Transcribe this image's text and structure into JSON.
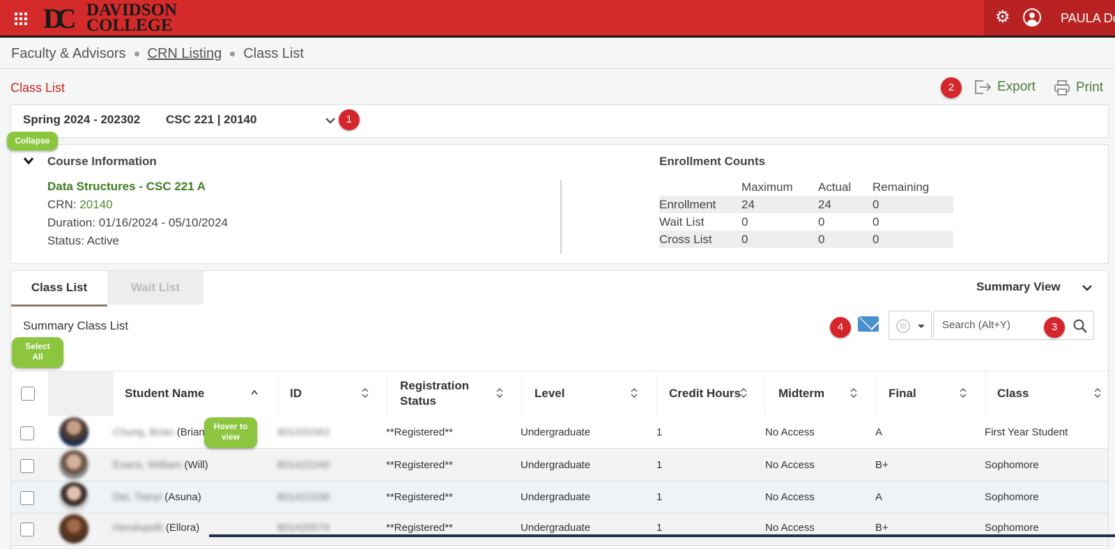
{
  "header": {
    "college_line1": "DAVIDSON",
    "college_line2": "COLLEGE",
    "logo_mark": "DC",
    "username": "PAULA Do",
    "brand_color": "#d42a2a"
  },
  "breadcrumb": {
    "items": [
      "Faculty & Advisors",
      "CRN Listing",
      "Class List"
    ]
  },
  "page_title": "Class List",
  "toolbar": {
    "export_label": "Export",
    "print_label": "Print"
  },
  "badges": [
    "1",
    "2",
    "3",
    "4"
  ],
  "course_selector": {
    "term": "Spring 2024 - 202302",
    "course": "CSC 221 | 20140"
  },
  "callouts": {
    "collapse": "Collapse",
    "select_all_1": "Select",
    "select_all_2": "All",
    "hover_1": "Hover to",
    "hover_2": "view"
  },
  "course_info": {
    "heading": "Course Information",
    "title": "Data Structures - CSC 221 A",
    "crn_label": "CRN:",
    "crn": "20140",
    "duration_label": "Duration:",
    "duration": "01/16/2024 - 05/10/2024",
    "status_label": "Status:",
    "status": "Active"
  },
  "enrollment": {
    "heading": "Enrollment Counts",
    "columns": [
      "Maximum",
      "Actual",
      "Remaining"
    ],
    "rows": [
      {
        "label": "Enrollment",
        "values": [
          "24",
          "24",
          "0"
        ]
      },
      {
        "label": "Wait List",
        "values": [
          "0",
          "0",
          "0"
        ]
      },
      {
        "label": "Cross List",
        "values": [
          "0",
          "0",
          "0"
        ]
      }
    ]
  },
  "tabs": [
    "Class List",
    "Wait List"
  ],
  "summary_view_label": "Summary View",
  "summary_title": "Summary Class List",
  "search": {
    "placeholder": "Search (Alt+Y)"
  },
  "table": {
    "columns": [
      "Student Name",
      "ID",
      "Registration",
      "Status",
      "Level",
      "Credit Hours",
      "Midterm",
      "Final",
      "Class"
    ],
    "rows": [
      {
        "name_blur": "Chung, Brian",
        "name_tail": "(Brian",
        "id": "801431562",
        "status": "**Registered**",
        "level": "Undergraduate",
        "credit": "1",
        "midterm": "No Access",
        "final": "A",
        "class": "First Year Student"
      },
      {
        "name_blur": "Evans, William",
        "name_tail": "(Will)",
        "id": "801422240",
        "status": "**Registered**",
        "level": "Undergraduate",
        "credit": "1",
        "midterm": "No Access",
        "final": "B+",
        "class": "Sophomore"
      },
      {
        "name_blur": "Dei, Tianyi",
        "name_tail": "(Asuna)",
        "id": "801421536",
        "status": "**Registered**",
        "level": "Undergraduate",
        "credit": "1",
        "midterm": "No Access",
        "final": "A",
        "class": "Sophomore"
      },
      {
        "name_blur": "Hendopolit",
        "name_tail": "(Ellora)",
        "id": "801420574",
        "status": "**Registered**",
        "level": "Undergraduate",
        "credit": "1",
        "midterm": "No Access",
        "final": "B+",
        "class": "Sophomore"
      }
    ]
  }
}
